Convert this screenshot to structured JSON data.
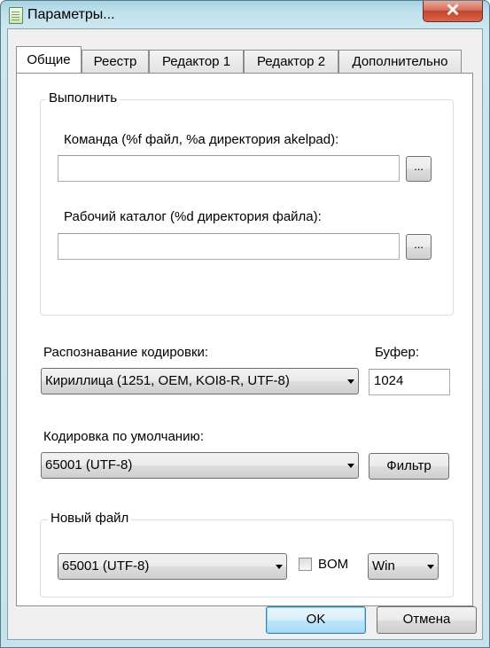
{
  "window": {
    "title": "Параметры..."
  },
  "tabs": [
    {
      "label": "Общие"
    },
    {
      "label": "Реестр"
    },
    {
      "label": "Редактор 1"
    },
    {
      "label": "Редактор 2"
    },
    {
      "label": "Дополнительно"
    }
  ],
  "execute": {
    "group_label": "Выполнить",
    "command_label": "Команда (%f файл, %a директория akelpad):",
    "command_value": "",
    "browse_label": "...",
    "workdir_label": "Рабочий каталог (%d директория файла):",
    "workdir_value": ""
  },
  "encoding": {
    "detect_label": "Распознавание кодировки:",
    "detect_value": "Кириллица (1251, OEM, KOI8-R, UTF-8)",
    "buffer_label": "Буфер:",
    "buffer_value": "1024",
    "default_label": "Кодировка по умолчанию:",
    "default_value": "65001 (UTF-8)",
    "filter_label": "Фильтр"
  },
  "new_file": {
    "group_label": "Новый файл",
    "encoding_value": "65001 (UTF-8)",
    "bom_label": "BOM",
    "bom_checked": false,
    "newline_value": "Win"
  },
  "buttons": {
    "ok": "OK",
    "cancel": "Отмена",
    "close_glyph": "✕"
  }
}
